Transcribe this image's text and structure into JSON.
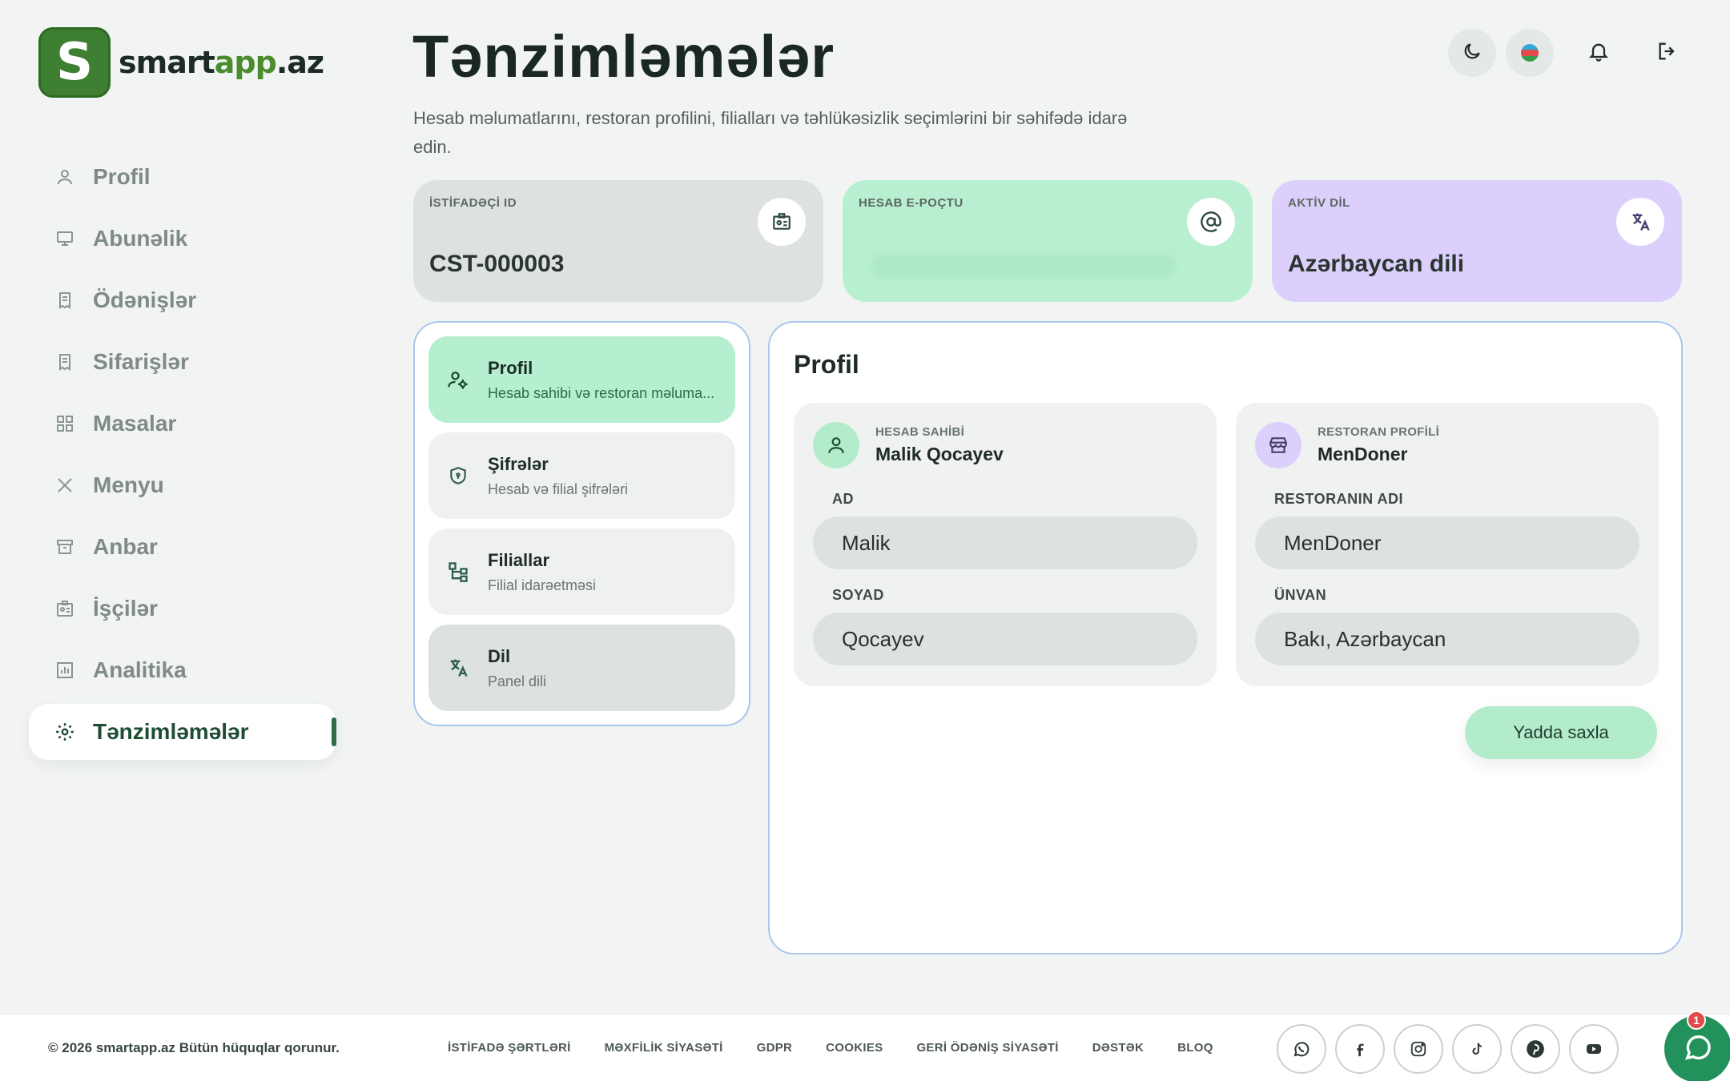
{
  "brand": {
    "name_part1": "smart",
    "name_part2": "app",
    "name_part3": ".az",
    "logo_letter": "S",
    "accent": "#3f7f31"
  },
  "sidebar": {
    "items": [
      {
        "label": "Profil",
        "icon": "user-icon"
      },
      {
        "label": "Abunəlik",
        "icon": "subscription-icon"
      },
      {
        "label": "Ödənişlər",
        "icon": "receipt-icon"
      },
      {
        "label": "Sifarişlər",
        "icon": "orders-icon"
      },
      {
        "label": "Masalar",
        "icon": "grid-icon"
      },
      {
        "label": "Menyu",
        "icon": "utensils-icon"
      },
      {
        "label": "Anbar",
        "icon": "archive-icon"
      },
      {
        "label": "İşçilər",
        "icon": "id-badge-icon"
      },
      {
        "label": "Analitika",
        "icon": "chart-icon"
      },
      {
        "label": "Tənzimləmələr",
        "icon": "gear-icon",
        "active": true
      }
    ]
  },
  "header": {
    "title": "Tənzimləmələr",
    "subtitle": "Hesab məlumatlarını, restoran profilini, filialları və təhlükəsizlik seçimlərini bir səhifədə idarə edin."
  },
  "stats": {
    "user_id": {
      "label": "İSTİFADƏÇİ ID",
      "value": "CST-000003"
    },
    "email": {
      "label": "HESAB E-POÇTU",
      "value": ""
    },
    "language": {
      "label": "AKTİV DİL",
      "value": "Azərbaycan dili"
    }
  },
  "tabs": [
    {
      "title": "Profil",
      "subtitle": "Hesab sahibi və restoran məluma..."
    },
    {
      "title": "Şifrələr",
      "subtitle": "Hesab və filial şifrələri"
    },
    {
      "title": "Filiallar",
      "subtitle": "Filial idarəetməsi"
    },
    {
      "title": "Dil",
      "subtitle": "Panel dili"
    }
  ],
  "profile": {
    "title": "Profil",
    "owner": {
      "small": "HESAB SAHİBİ",
      "name": "Malik Qocayev"
    },
    "restaurant": {
      "small": "RESTORAN PROFİLİ",
      "name": "MenDoner"
    },
    "fields": {
      "first_name": {
        "label": "AD",
        "value": "Malik"
      },
      "last_name": {
        "label": "SOYAD",
        "value": "Qocayev"
      },
      "restaurant_name": {
        "label": "RESTORANIN ADI",
        "value": "MenDoner"
      },
      "address": {
        "label": "ÜNVAN",
        "value": "Bakı, Azərbaycan"
      }
    },
    "save_label": "Yadda saxla"
  },
  "footer": {
    "copyright": "© 2026 smartapp.az Bütün hüquqlar qorunur.",
    "links": [
      "İSTİFADƏ ŞƏRTLƏRİ",
      "MƏXFİLİK SİYASƏTİ",
      "GDPR",
      "COOKIES",
      "GERİ ÖDƏNİŞ SİYASƏTİ",
      "DƏSTƏK",
      "BLOQ"
    ],
    "socials": [
      "whatsapp-icon",
      "facebook-icon",
      "instagram-icon",
      "tiktok-icon",
      "pinterest-icon",
      "youtube-icon"
    ]
  },
  "chat": {
    "badge": "1"
  }
}
